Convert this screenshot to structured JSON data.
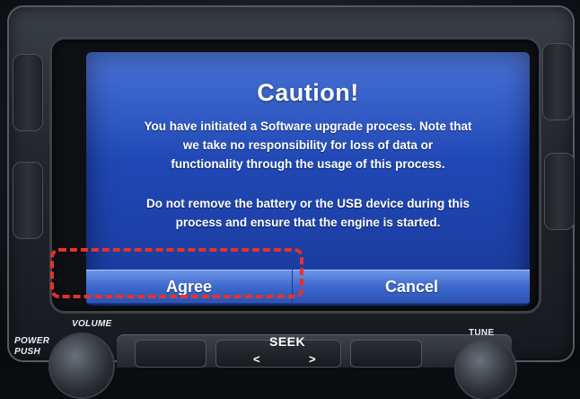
{
  "dialog": {
    "title": "Caution!",
    "message_lines": [
      "You have initiated a Software upgrade process. Note that",
      "we take no responsibility for loss of data or",
      "functionality through the usage of this process."
    ],
    "warning_lines": [
      "Do not remove the battery or the USB device during this",
      "process and ensure that the engine is started."
    ],
    "agree_label": "Agree",
    "cancel_label": "Cancel"
  },
  "panel": {
    "volume_label": "VOLUME",
    "power_label_1": "POWER",
    "power_label_2": "PUSH",
    "seek_label": "SEEK",
    "seek_prev": "<",
    "seek_next": ">",
    "tune_label": "TUNE"
  },
  "annotation": {
    "highlight_color": "#e4322b",
    "highlighted_button": "Agree"
  },
  "colors": {
    "screen_blue": "#1f47b4",
    "button_blue": "#3d68cc"
  }
}
